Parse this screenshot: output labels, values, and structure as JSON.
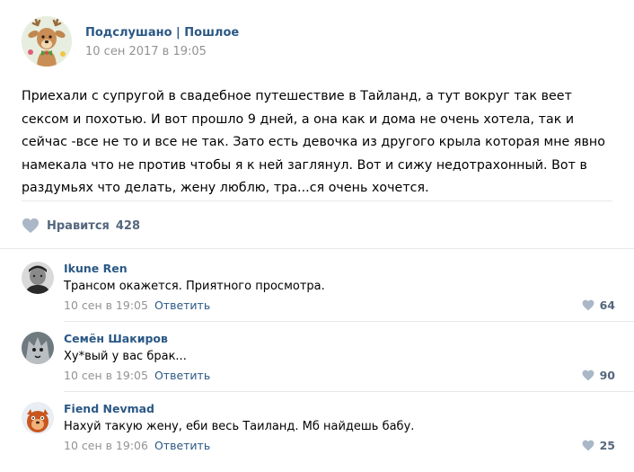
{
  "post": {
    "group_name": "Подслушано | Пошлое",
    "date": "10 сен 2017 в 19:05",
    "text": "Приехали с супругой в свадебное путешествие в Тайланд, а тут вокруг так веет сексом и похотью. И вот прошло 9 дней, а она как и дома не очень хотела, так и сейчас -все не то и все не так. Зато есть девочка из другого крыла которая мне явно намекала что не против чтобы я к ней заглянул. Вот и сижу недотрахонный. Вот в раздумьях что делать, жену люблю, тра...ся очень хочется.",
    "likes_label": "Нравится",
    "likes_count": "428"
  },
  "comments": [
    {
      "author": "Ikune Ren",
      "text": "Трансом окажется. Приятного просмотра.",
      "date": "10 сен в 19:05",
      "reply_label": "Ответить",
      "likes": "64"
    },
    {
      "author": "Семён Шакиров",
      "text": "Ху*вый у вас брак...",
      "date": "10 сен в 19:05",
      "reply_label": "Ответить",
      "likes": "90"
    },
    {
      "author": "Fiend Nevmad",
      "text": "Нахуй такую жену, еби весь Таиланд. Мб найдешь бабу.",
      "date": "10 сен в 19:06",
      "reply_label": "Ответить",
      "likes": "25"
    }
  ],
  "colors": {
    "link": "#2a5885",
    "meta": "#939393",
    "like_icon": "#aab7c6",
    "divider": "#e7e8ec"
  },
  "icons": {
    "like": "heart-icon",
    "group_avatar": "deer-mascot",
    "user_avatars": [
      "avatar-photo",
      "avatar-photo",
      "avatar-cartoon"
    ]
  }
}
